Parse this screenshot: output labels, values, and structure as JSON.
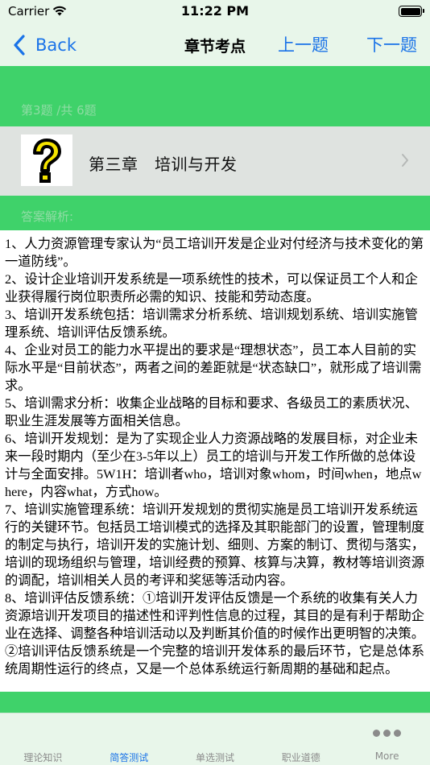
{
  "status_bar": {
    "carrier": "Carrier",
    "time": "11:22 PM"
  },
  "nav": {
    "back_label": "Back",
    "title": "章节考点",
    "prev_label": "上一题",
    "next_label": "下一题"
  },
  "question": {
    "index_text": "第3题 /共 6题",
    "chapter_title": "第三章　培训与开发",
    "answer_label": "答案解析:",
    "answer_text": "1、人力资源管理专家认为“员工培训开发是企业对付经济与技术变化的第一道防线”。\n2、设计企业培训开发系统是一项系统性的技术，可以保证员工个人和企业获得履行岗位职责所必需的知识、技能和劳动态度。\n3、培训开发系统包括：培训需求分析系统、培训规划系统、培训实施管理系统、培训评估反馈系统。\n4、企业对员工的能力水平提出的要求是“理想状态”，员工本人目前的实际水平是“目前状态”，两者之间的差距就是“状态缺口”，就形成了培训需求。\n5、培训需求分析：收集企业战略的目标和要求、各级员工的素质状况、职业生涯发展等方面相关信息。\n6、培训开发规划：是为了实现企业人力资源战略的发展目标，对企业未来一段时期内（至少在3-5年以上）员工的培训与开发工作所做的总体设计与全面安排。5W1H：培训者who，培训对象whom，时间when，地点where，内容what，方式how。\n7、培训实施管理系统：培训开发规划的贯彻实施是员工培训开发系统运行的关键环节。包括员工培训模式的选择及其职能部门的设置，管理制度的制定与执行，培训开发的实施计划、细则、方案的制订、贯彻与落实，培训的现场组织与管理，培训经费的预算、核算与决算，教材等培训资源的调配，培训相关人员的考评和奖惩等活动内容。\n8、培训评估反馈系统：①培训开发评估反馈是一个系统的收集有关人力资源培训开发项目的描述性和评判性信息的过程，其目的是有利于帮助企业在选择、调整各种培训活动以及判断其价值的时候作出更明智的决策。②培训评估反馈系统是一个完整的培训开发体系的最后环节，它是总体系统周期性运行的终点，又是一个总体系统运行新周期的基础和起点。"
  },
  "tabs": [
    {
      "label": "理论知识",
      "active": false
    },
    {
      "label": "简答测试",
      "active": true
    },
    {
      "label": "单选测试",
      "active": false
    },
    {
      "label": "职业道德",
      "active": false
    },
    {
      "label": "More",
      "active": false
    }
  ],
  "colors": {
    "band_green": "#3fd26a",
    "accent_blue": "#1a73e8",
    "chrome_bg": "#e8f6ea",
    "icon_yellow": "#f5e400"
  },
  "icons": {
    "question": "question-mark-icon",
    "more": "more-dots-icon"
  }
}
